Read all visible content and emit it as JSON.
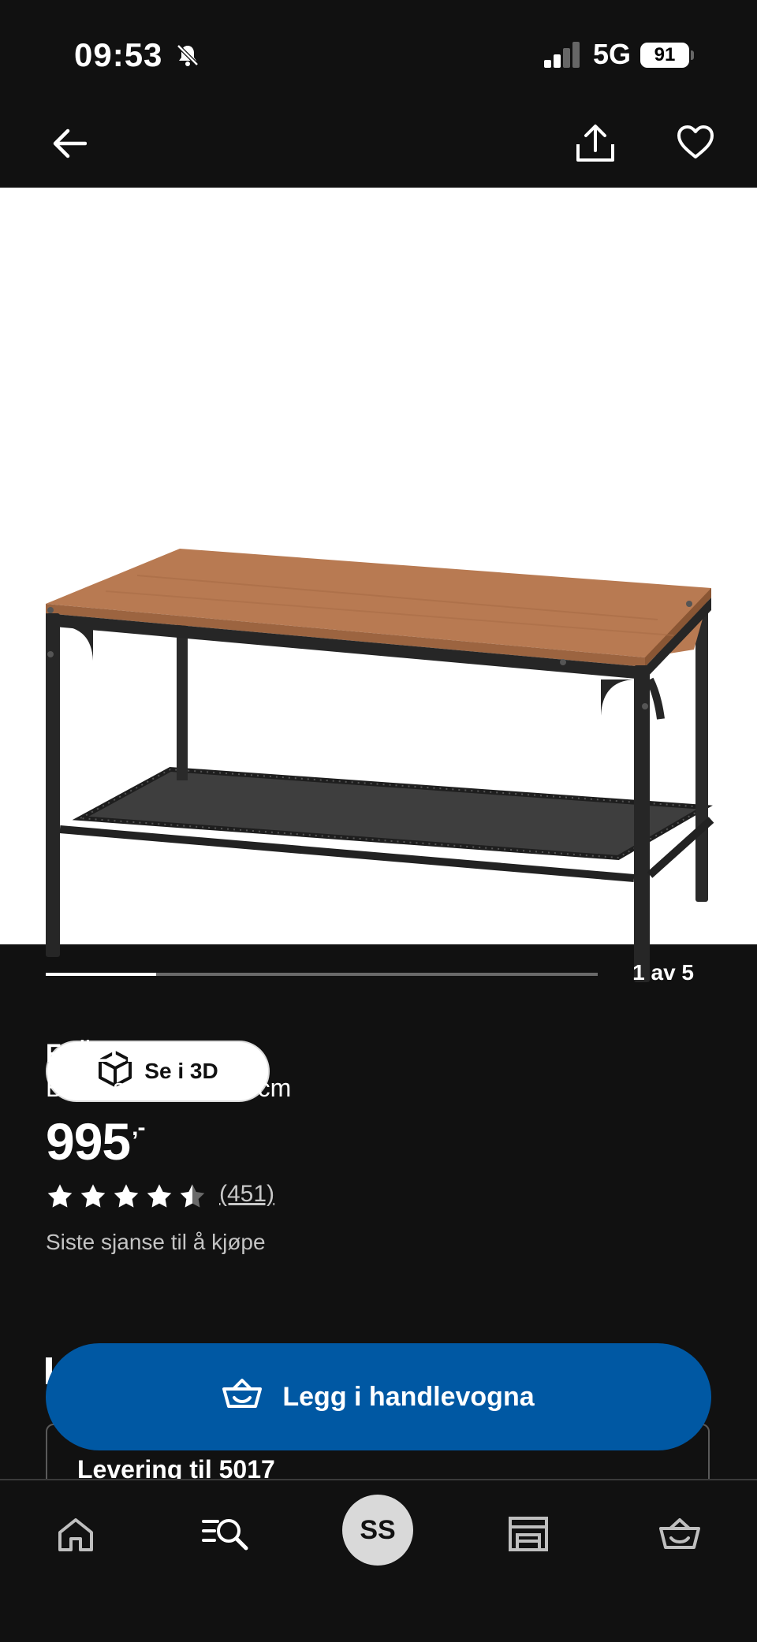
{
  "status_bar": {
    "time": "09:53",
    "network": "5G",
    "battery": "91"
  },
  "gallery": {
    "see_3d_label": "Se i 3D",
    "position_label": "1 av 5",
    "progress": 0.2
  },
  "product": {
    "name": "FJÄLLBO",
    "description": "Bord, svart, 90x46 cm",
    "price": "995",
    "price_suffix": ",-",
    "rating": 4.5,
    "rating_count": "(451)",
    "stock_note": "Siste sjanse til å kjøpe"
  },
  "cart_button": {
    "label": "Legg i handlevogna"
  },
  "delivery": {
    "label": "Levering til 5017"
  },
  "bottom_nav": {
    "avatar_initials": "SS"
  },
  "colors": {
    "background": "#111111",
    "accent": "#0058a3",
    "image_bg": "#ffffff"
  }
}
